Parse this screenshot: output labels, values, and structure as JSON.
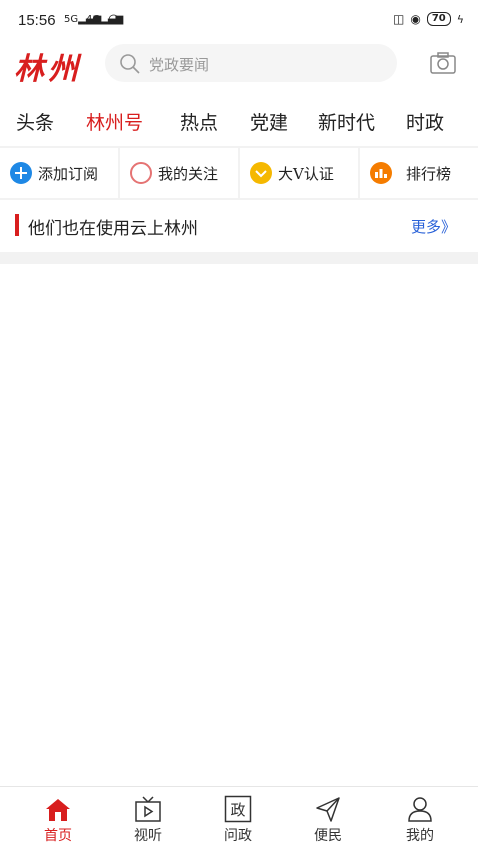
{
  "status": {
    "time": "15:56",
    "signal1": "5G",
    "signal2": "4G",
    "battery": "70"
  },
  "header": {
    "logo": "林州",
    "search_placeholder": "党政要闻"
  },
  "tabs": [
    {
      "label": "头条",
      "active": false
    },
    {
      "label": "林州号",
      "active": true
    },
    {
      "label": "热点",
      "active": false
    },
    {
      "label": "党建",
      "active": false
    },
    {
      "label": "新时代",
      "active": false
    },
    {
      "label": "时政",
      "active": false
    }
  ],
  "quick": [
    {
      "label": "添加订阅",
      "icon": "plus-circle-icon",
      "color": "#1e88e5"
    },
    {
      "label": "我的关注",
      "icon": "circle-icon",
      "color": "#e57373"
    },
    {
      "label": "大V认证",
      "icon": "check-circle-icon",
      "color": "#f5b800"
    },
    {
      "label": "排行榜",
      "icon": "ranking-icon",
      "color": "#f57c00"
    }
  ],
  "section": {
    "title": "他们也在使用云上林州",
    "more": "更多》"
  },
  "bottom_nav": [
    {
      "label": "首页",
      "icon": "home-icon",
      "active": true
    },
    {
      "label": "视听",
      "icon": "tv-icon",
      "active": false
    },
    {
      "label": "问政",
      "icon": "zheng-icon",
      "active": false
    },
    {
      "label": "便民",
      "icon": "send-icon",
      "active": false
    },
    {
      "label": "我的",
      "icon": "user-icon",
      "active": false
    }
  ],
  "colors": {
    "accent": "#d81e1e",
    "link": "#2a62d8"
  }
}
